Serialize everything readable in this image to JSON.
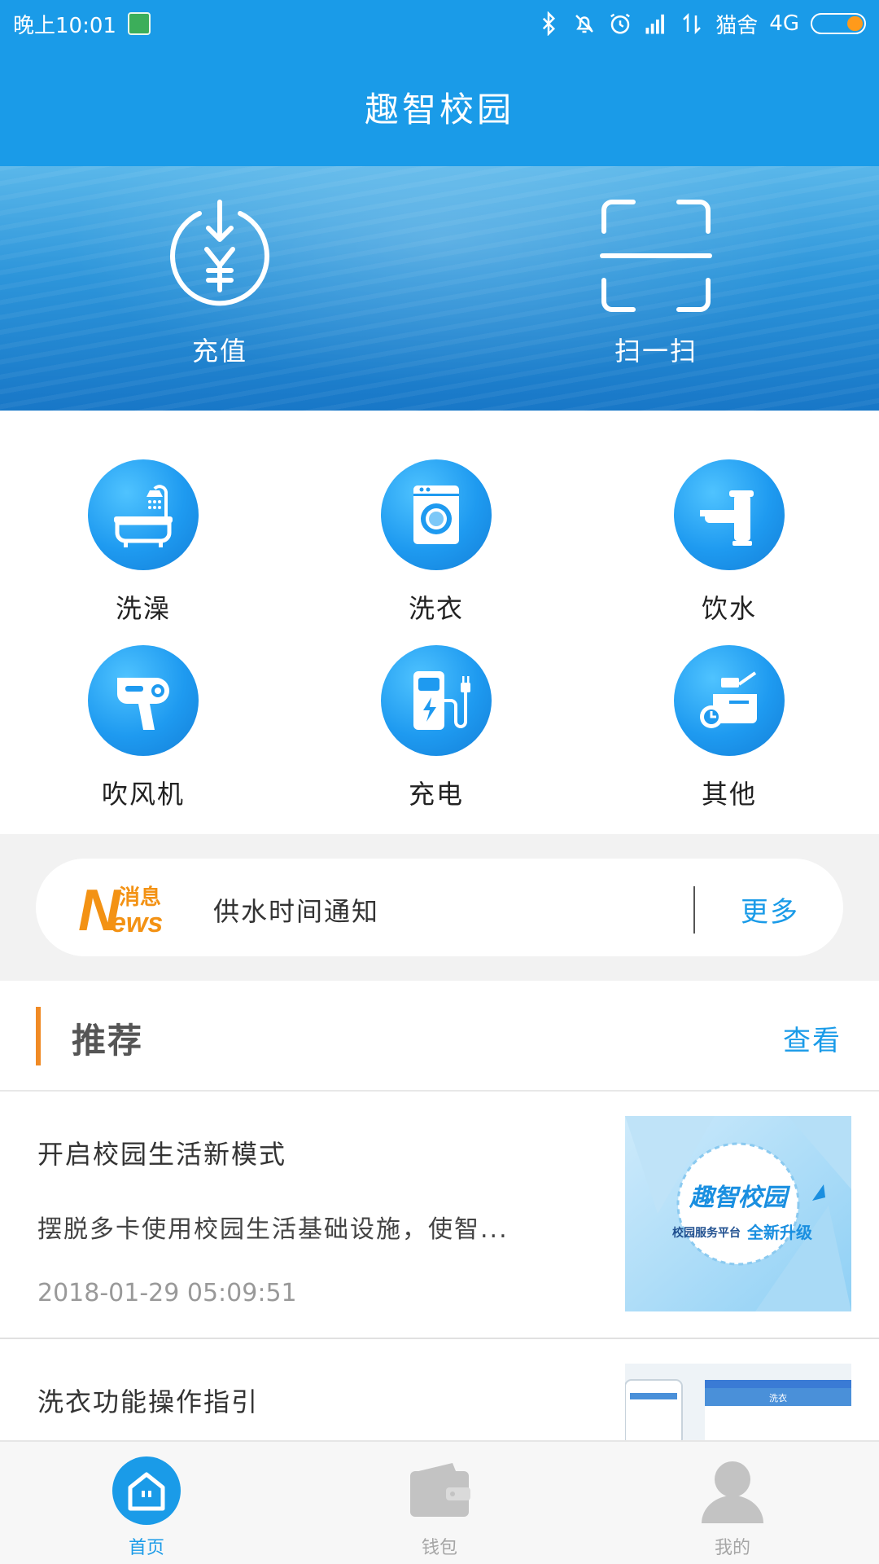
{
  "status_bar": {
    "time": "晚上10:01",
    "carrier": "猫舍",
    "network": "4G",
    "battery_level": 0.3,
    "icons": [
      "bluetooth-icon",
      "notifications-off-icon",
      "alarm-icon",
      "signal-icon",
      "data-transfer-icon",
      "battery-icon"
    ]
  },
  "header": {
    "title": "趣智校园"
  },
  "hero": {
    "actions": [
      {
        "label": "充值",
        "icon": "recharge-yen-icon"
      },
      {
        "label": "扫一扫",
        "icon": "scan-icon"
      }
    ]
  },
  "services": [
    {
      "label": "洗澡",
      "icon": "bathtub-shower-icon"
    },
    {
      "label": "洗衣",
      "icon": "washing-machine-icon"
    },
    {
      "label": "饮水",
      "icon": "faucet-icon"
    },
    {
      "label": "吹风机",
      "icon": "hair-dryer-icon"
    },
    {
      "label": "充电",
      "icon": "charging-station-icon"
    },
    {
      "label": "其他",
      "icon": "other-device-icon"
    }
  ],
  "notice": {
    "logo_text_cn": "消息",
    "logo_text_en": "News",
    "text": "供水时间通知",
    "more_label": "更多"
  },
  "recommend": {
    "title": "推荐",
    "view_label": "查看",
    "articles": [
      {
        "title": "开启校园生活新模式",
        "desc": "摆脱多卡使用校园生活基础设施，使智...",
        "time": "2018-01-29 05:09:51",
        "thumb_title": "趣智校园",
        "thumb_sub1": "校园服务平台",
        "thumb_sub2": "全新升级"
      },
      {
        "title": "洗衣功能操作指引",
        "thumb_text": "洗衣"
      }
    ]
  },
  "tabs": [
    {
      "label": "首页",
      "icon": "home-icon",
      "active": true
    },
    {
      "label": "钱包",
      "icon": "wallet-icon",
      "active": false
    },
    {
      "label": "我的",
      "icon": "user-icon",
      "active": false
    }
  ],
  "colors": {
    "primary": "#1a9be8",
    "accent": "#f08a24",
    "text_dark": "#333333",
    "text_muted": "#999999"
  }
}
